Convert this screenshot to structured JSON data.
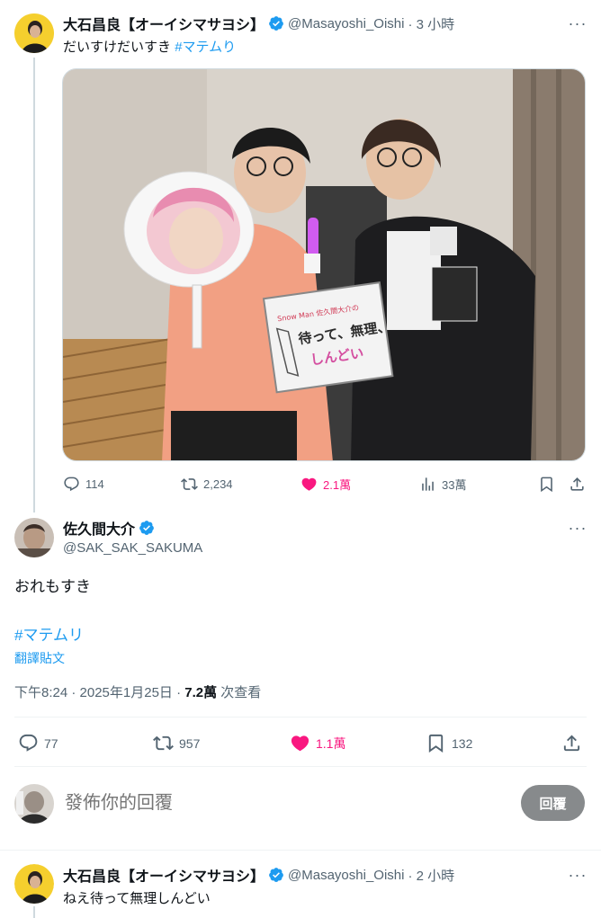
{
  "tweet1": {
    "name": "大石昌良【オーイシマサヨシ】",
    "handle": "@Masayoshi_Oishi",
    "time": "· 3 小時",
    "text": "だいすけだいすき",
    "hashtag": "#マテムり",
    "image": {
      "fan_text": "Snow Man 佐久間大介の",
      "sign_line1": "待って、無理、",
      "sign_line2": "しんどい"
    },
    "actions": {
      "replies": "114",
      "retweets": "2,234",
      "likes": "2.1萬",
      "views": "33萬"
    }
  },
  "tweet2": {
    "name": "佐久間大介",
    "handle": "@SAK_SAK_SAKUMA",
    "text": "おれもすき",
    "hashtag": "#マテムリ",
    "translate": "翻譯貼文",
    "timestamp": "下午8:24 · 2025年1月25日 · ",
    "views_count": "7.2萬",
    "views_label": " 次查看",
    "actions": {
      "replies": "77",
      "retweets": "957",
      "likes": "1.1萬",
      "bookmarks": "132"
    }
  },
  "reply_box": {
    "placeholder": "發佈你的回覆",
    "button": "回覆"
  },
  "tweet3": {
    "name": "大石昌良【オーイシマサヨシ】",
    "handle": "@Masayoshi_Oishi",
    "time": "· 2 小時",
    "text": "ねえ待って無理しんどい"
  },
  "colors": {
    "accent": "#1d9bf0",
    "like": "#f91880",
    "muted": "#536471",
    "button_bg": "#878a8c"
  }
}
